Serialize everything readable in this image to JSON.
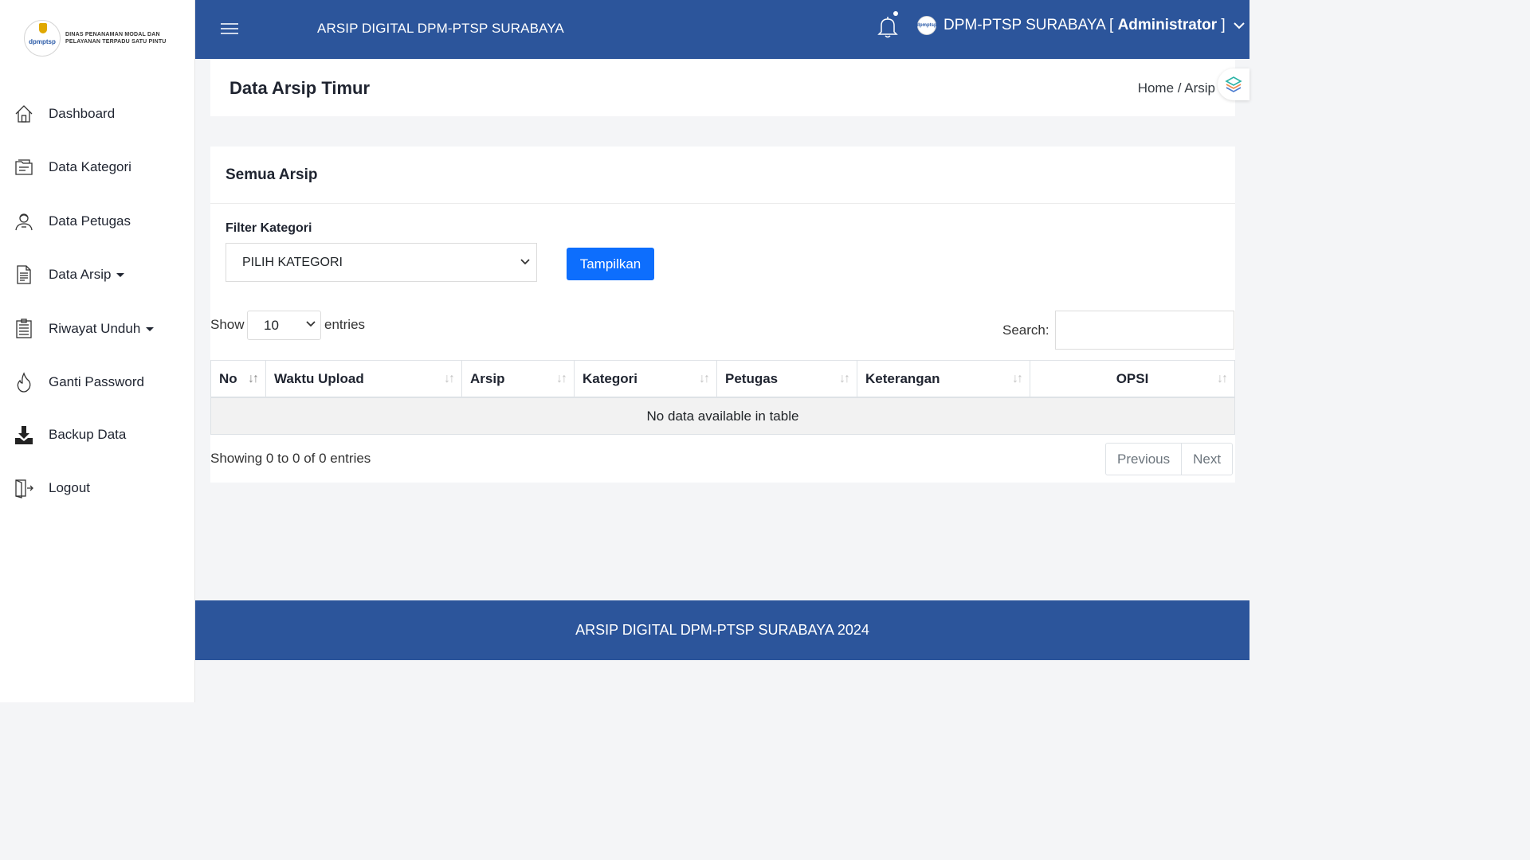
{
  "sidebar": {
    "logo_text_line1": "DINAS PENANAMAN MODAL DAN",
    "logo_text_line2": "PELAYANAN TERPADU SATU PINTU",
    "logo_mini": "dpmptsp",
    "items": [
      {
        "label": "Dashboard",
        "icon": "home-icon"
      },
      {
        "label": "Data Kategori",
        "icon": "folder-icon"
      },
      {
        "label": "Data Petugas",
        "icon": "user-icon"
      },
      {
        "label": "Data Arsip",
        "icon": "document-icon",
        "dropdown": true
      },
      {
        "label": "Riwayat Unduh",
        "icon": "archive-icon",
        "dropdown": true
      },
      {
        "label": "Ganti Password",
        "icon": "flame-icon"
      },
      {
        "label": "Backup Data",
        "icon": "download-icon"
      },
      {
        "label": "Logout",
        "icon": "logout-icon"
      }
    ]
  },
  "header": {
    "title": "ARSIP DIGITAL DPM-PTSP SURABAYA",
    "user_org": "DPM-PTSP SURABAYA [ ",
    "user_role": "Administrator",
    "user_close": " ]",
    "avatar_text": "dpmptsp"
  },
  "page": {
    "title": "Data Arsip Timur",
    "breadcrumb": "Home / Arsip"
  },
  "card": {
    "title": "Semua Arsip",
    "filter_label": "Filter Kategori",
    "filter_value": "PILIH KATEGORI",
    "button_label": "Tampilkan",
    "show_label": "Show",
    "entries_value": "10",
    "entries_label": "entries",
    "search_label": "Search:",
    "columns": [
      "No",
      "Waktu Upload",
      "Arsip",
      "Kategori",
      "Petugas",
      "Keterangan",
      "OPSI"
    ],
    "sort_icon": "↓↑",
    "empty_text": "No data available in table",
    "info_text": "Showing 0 to 0 of 0 entries",
    "prev_label": "Previous",
    "next_label": "Next"
  },
  "footer": {
    "text": "ARSIP DIGITAL DPM-PTSP SURABAYA 2024"
  },
  "colors": {
    "header_bg": "#2c559b",
    "primary_button": "#0d6efd"
  }
}
